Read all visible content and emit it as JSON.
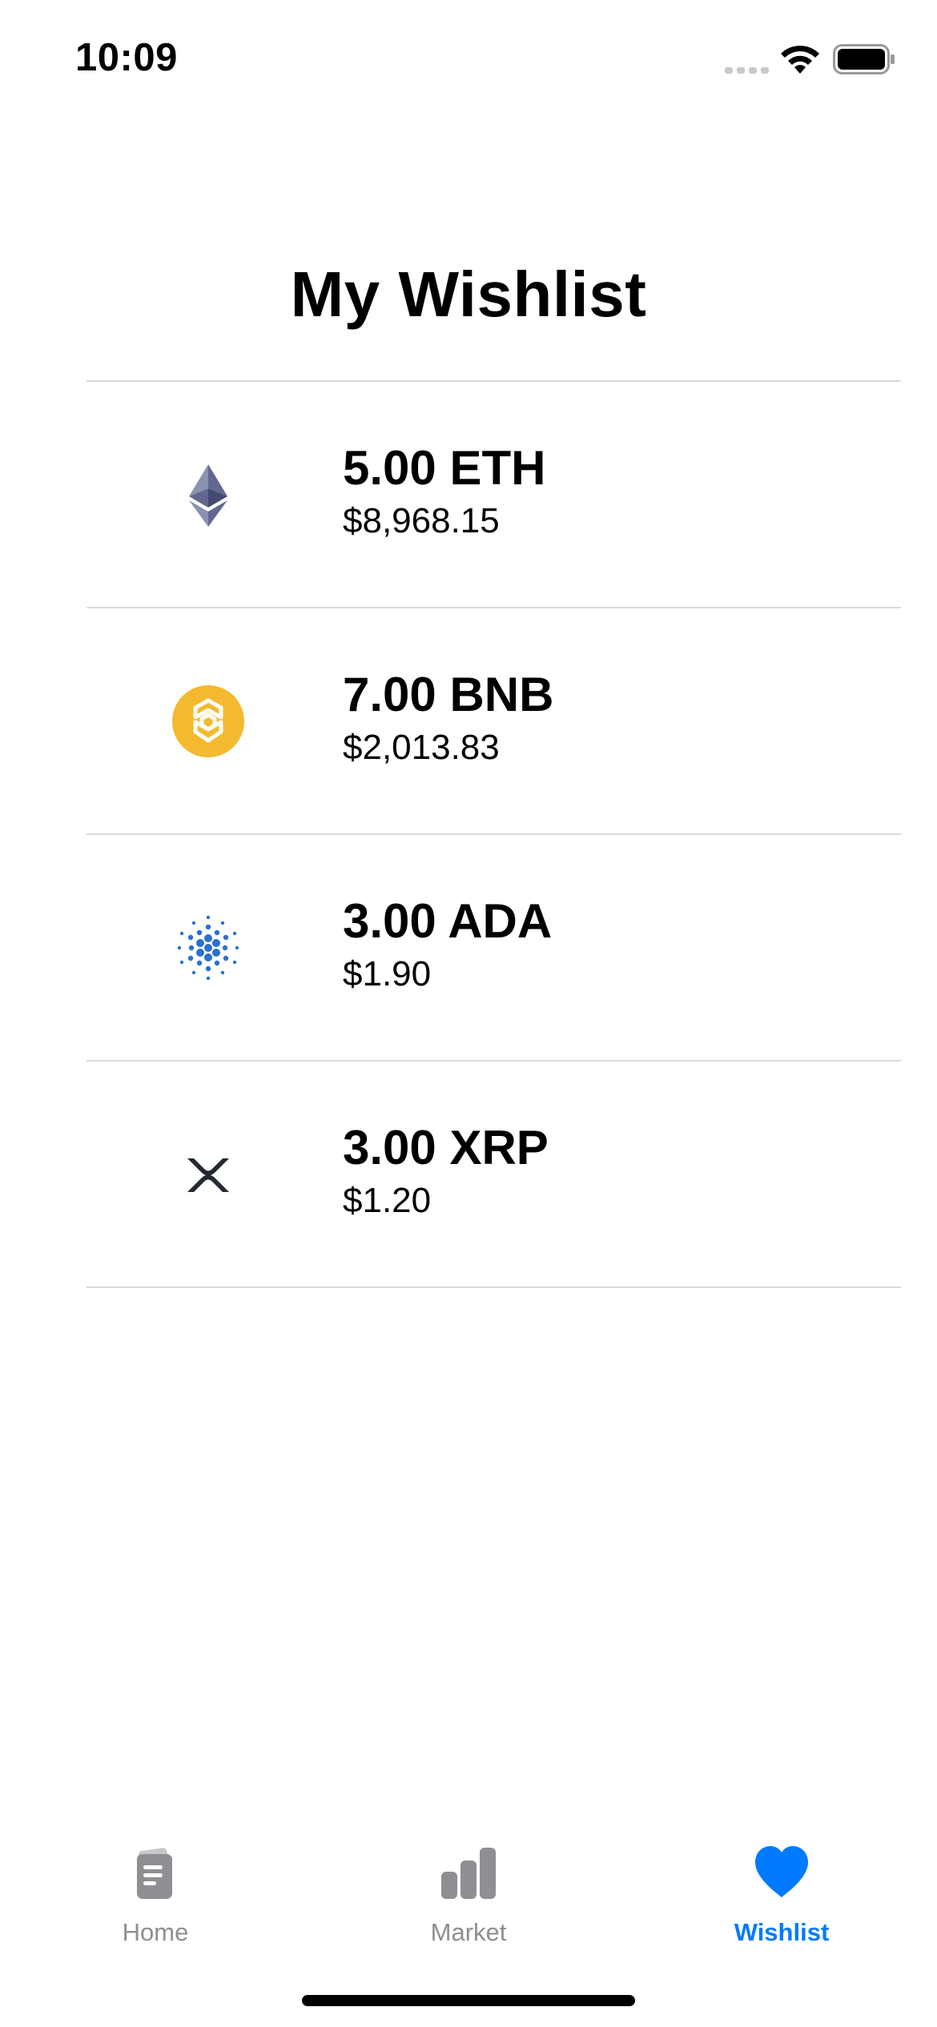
{
  "status_bar": {
    "time": "10:09"
  },
  "page": {
    "title": "My Wishlist"
  },
  "wishlist": {
    "items": [
      {
        "amount": "5.00 ETH",
        "value": "$8,968.15",
        "icon": "ethereum-icon",
        "color": "#62688f"
      },
      {
        "amount": "7.00 BNB",
        "value": "$2,013.83",
        "icon": "binance-coin-icon",
        "color": "#f3ba2f"
      },
      {
        "amount": "3.00 ADA",
        "value": "$1.90",
        "icon": "cardano-icon",
        "color": "#2a71d0"
      },
      {
        "amount": "3.00 XRP",
        "value": "$1.20",
        "icon": "xrp-icon",
        "color": "#23292f"
      }
    ]
  },
  "tab_bar": {
    "tabs": [
      {
        "label": "Home",
        "icon": "home-icon",
        "active": false
      },
      {
        "label": "Market",
        "icon": "market-bar-chart-icon",
        "active": false
      },
      {
        "label": "Wishlist",
        "icon": "heart-icon",
        "active": true
      }
    ],
    "active_color": "#007aff",
    "inactive_color": "#8e8e93"
  }
}
